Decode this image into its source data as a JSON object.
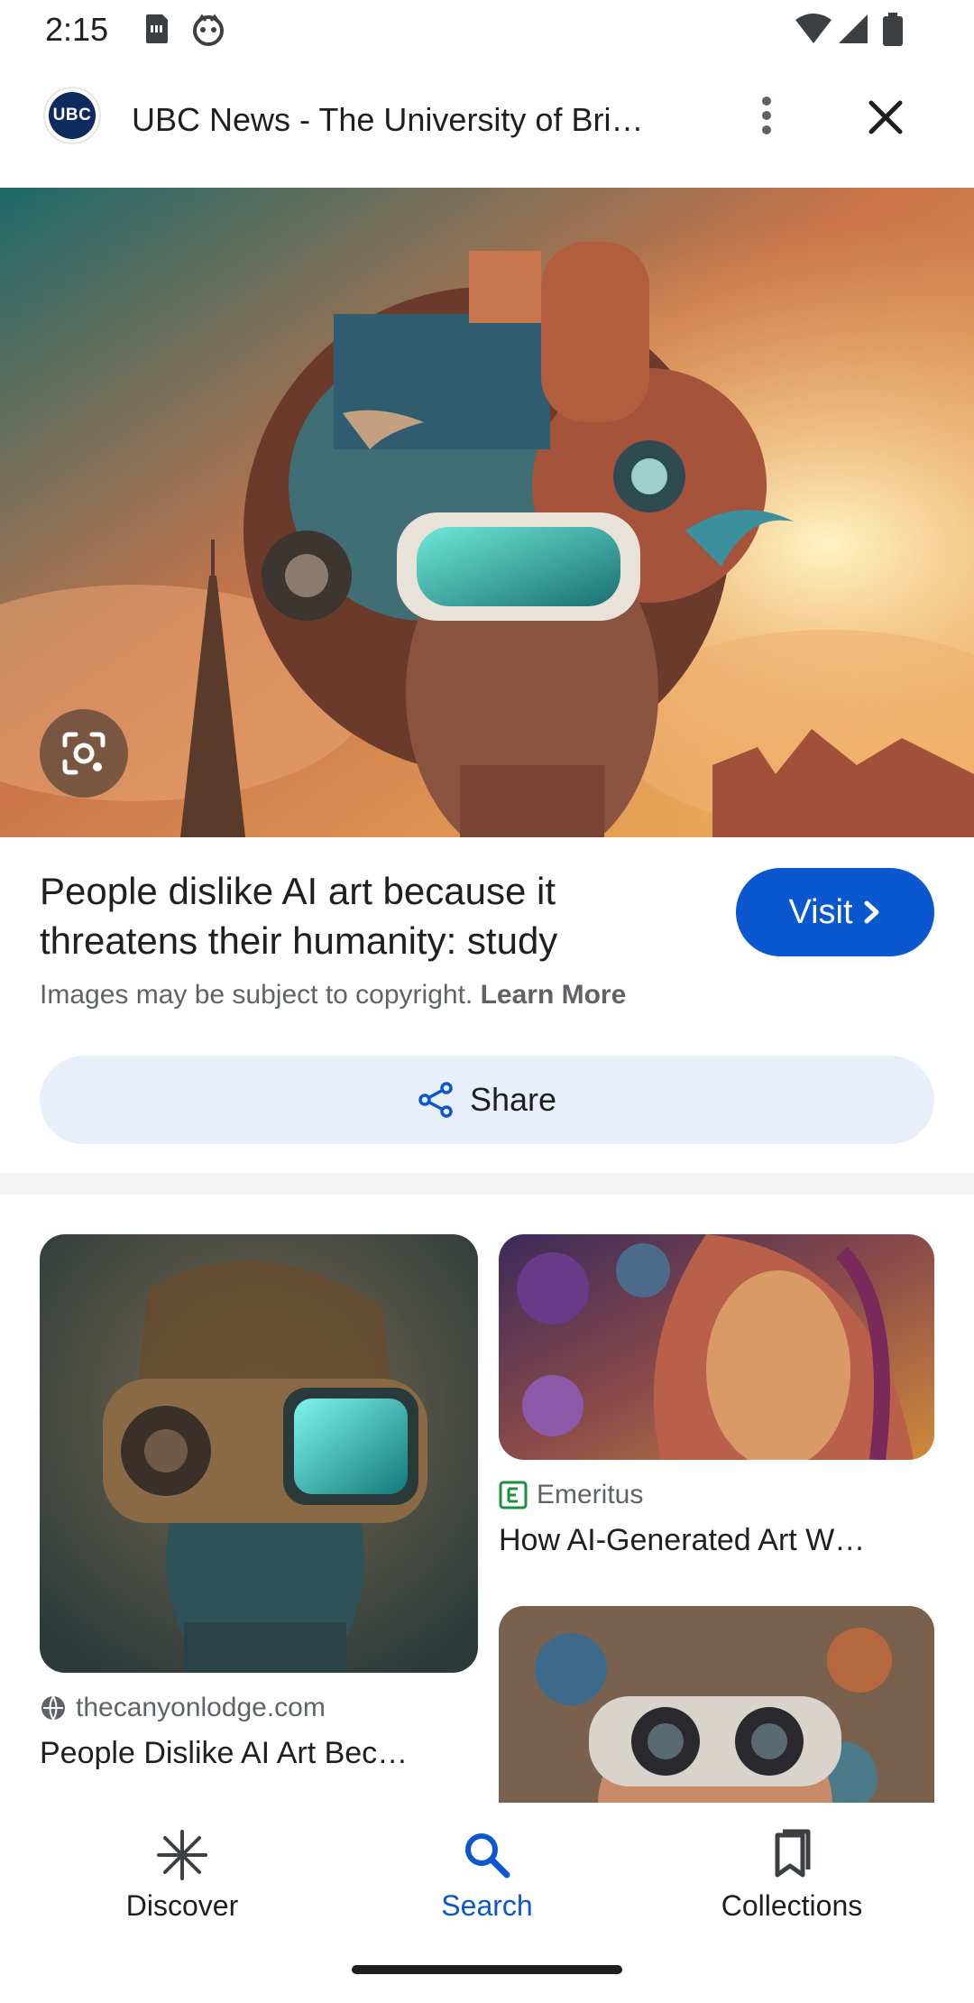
{
  "status": {
    "time": "2:15"
  },
  "header": {
    "logo_text": "UBC",
    "title": "UBC News - The University of Bri…"
  },
  "result": {
    "title": "People dislike AI art because it threatens their humanity: study",
    "visit_label": "Visit",
    "copyright_text": "Images may be subject to copyright.",
    "learn_more_label": "Learn More",
    "share_label": "Share"
  },
  "related": [
    {
      "source": "thecanyonlodge.com",
      "title": "People Dislike AI Art Bec…",
      "source_icon": "globe-icon"
    },
    {
      "source": "Emeritus",
      "title": "How AI-Generated Art W…",
      "source_icon": "emeritus-logo-icon"
    }
  ],
  "nav": [
    {
      "label": "Discover",
      "icon": "asterisk-icon",
      "active": false
    },
    {
      "label": "Search",
      "icon": "search-icon",
      "active": true
    },
    {
      "label": "Collections",
      "icon": "collections-icon",
      "active": false
    }
  ],
  "colors": {
    "accent": "#0b57d0",
    "share_bg": "#e9effa"
  }
}
